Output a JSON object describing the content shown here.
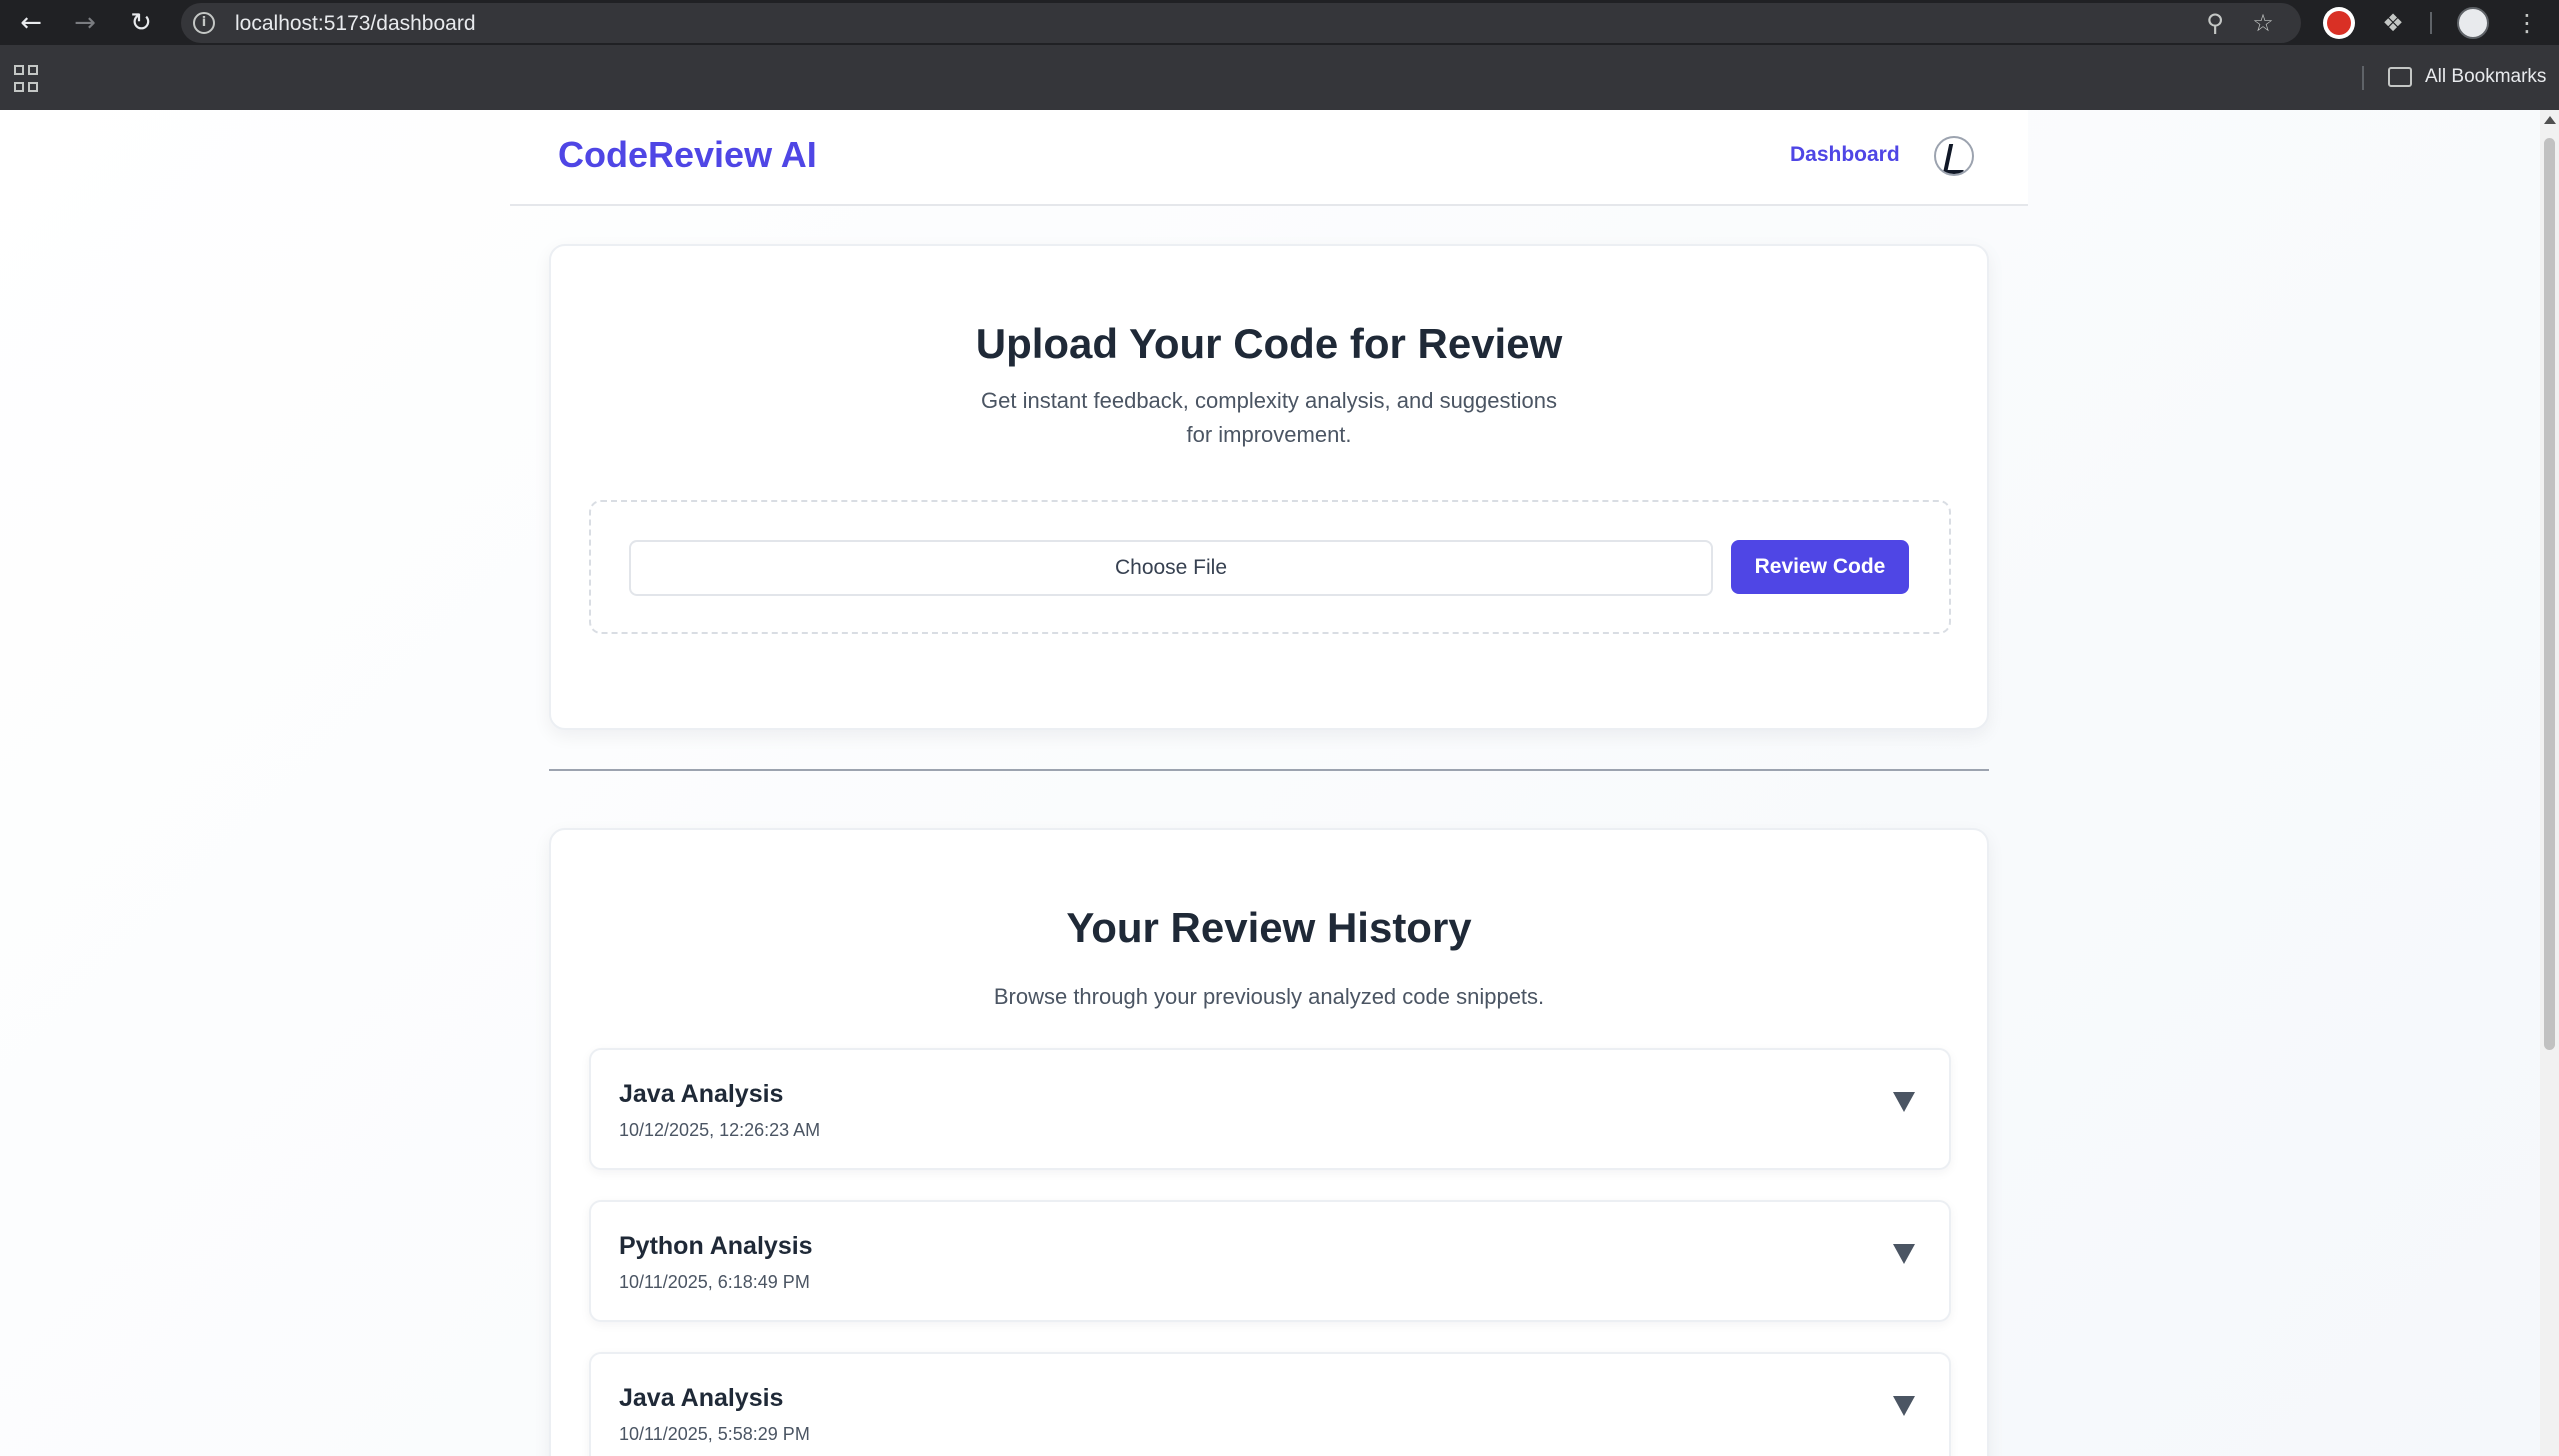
{
  "browser": {
    "url": "localhost:5173/dashboard",
    "bookmarks_label": "All Bookmarks",
    "icons": [
      "back-icon",
      "forward-icon",
      "reload-icon",
      "site-info-icon",
      "zoom-icon",
      "star-icon",
      "extension-icon",
      "puzzle-icon",
      "profile-icon",
      "menu-icon",
      "apps-icon",
      "folder-icon"
    ]
  },
  "header": {
    "brand": "CodeReview AI",
    "nav_dashboard": "Dashboard"
  },
  "upload": {
    "title": "Upload Your Code for Review",
    "subtitle_line1": "Get instant feedback, complexity analysis, and suggestions",
    "subtitle_line2": "for improvement.",
    "file_input_label": "Choose File",
    "review_button": "Review Code"
  },
  "history": {
    "title": "Your Review History",
    "subtitle": "Browse through your previously analyzed code snippets.",
    "items": [
      {
        "title": "Java Analysis",
        "date": "10/12/2025, 12:26:23 AM"
      },
      {
        "title": "Python Analysis",
        "date": "10/11/2025, 6:18:49 PM"
      },
      {
        "title": "Java Analysis",
        "date": "10/11/2025, 5:58:29 PM"
      }
    ]
  },
  "colors": {
    "brand": "#4f46e5",
    "heading": "#1f2937",
    "muted": "#4b5563",
    "chrome_dark": "#202124"
  }
}
